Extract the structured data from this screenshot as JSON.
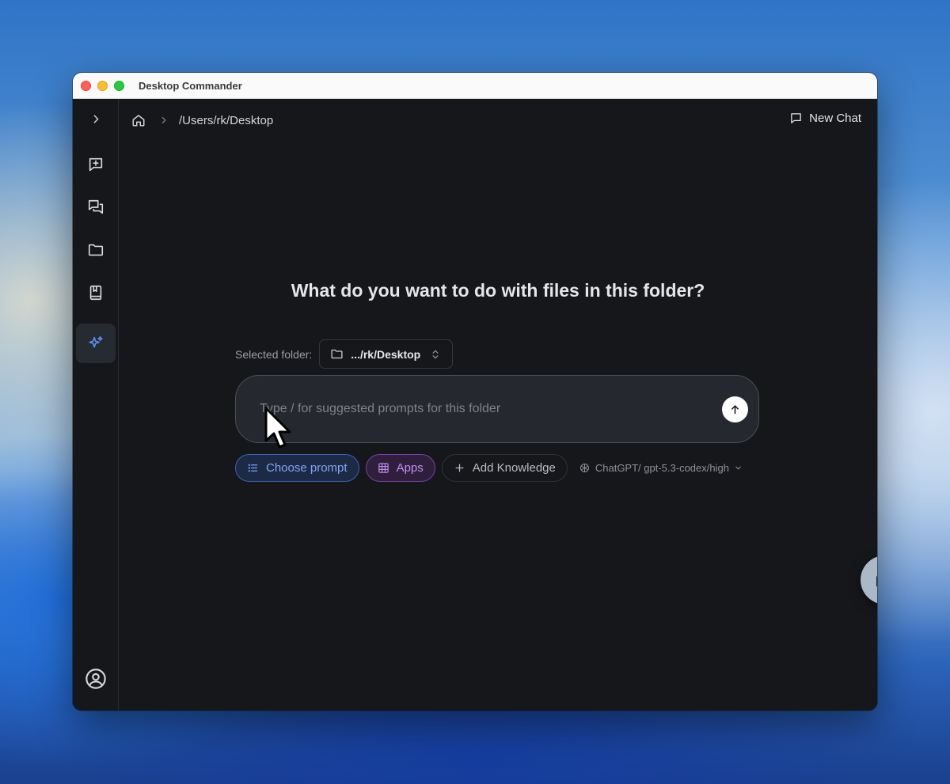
{
  "window": {
    "title": "Desktop Commander"
  },
  "sidebar": {
    "items": [
      {
        "name": "expand",
        "icon": "chevron-right-icon"
      },
      {
        "name": "new-chat",
        "icon": "message-plus-icon"
      },
      {
        "name": "chats",
        "icon": "messages-icon"
      },
      {
        "name": "folders",
        "icon": "folder-icon"
      },
      {
        "name": "library",
        "icon": "book-icon"
      },
      {
        "name": "prompts",
        "icon": "sparkles-icon",
        "active": true
      }
    ],
    "account_icon": "user-circle-icon"
  },
  "header": {
    "breadcrumb_path": "/Users/rk/Desktop",
    "new_chat_label": "New Chat"
  },
  "main": {
    "heading": "What do you want to do with files in this folder?",
    "selected_folder_label": "Selected folder:",
    "selected_folder_value": ".../rk/Desktop",
    "prompt_placeholder": "Type / for suggested prompts for this folder",
    "chips": {
      "choose_prompt": "Choose prompt",
      "apps": "Apps",
      "add_knowledge": "Add Knowledge"
    },
    "model": "ChatGPT/ gpt-5.3-codex/high"
  },
  "colors": {
    "accent_blue": "#5b8ff0",
    "apps_purple": "#c78ff0",
    "background": "#15171b"
  }
}
